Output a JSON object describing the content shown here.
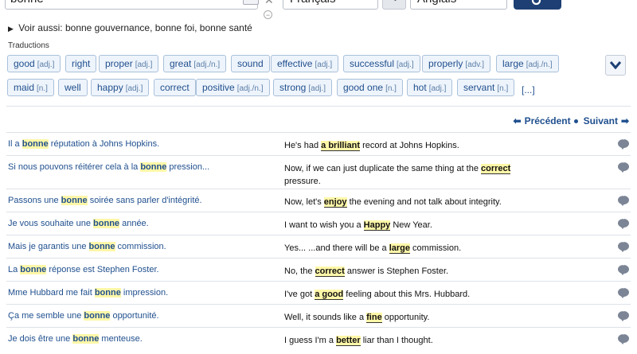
{
  "search": {
    "value": "bonne"
  },
  "lang": {
    "from": "Français",
    "to": "Anglais"
  },
  "see_also": {
    "label": "Voir aussi:",
    "items": [
      "bonne gouvernance",
      "bonne foi",
      "bonne santé"
    ],
    "sep": ", "
  },
  "translations_label": "Traductions",
  "chips": [
    {
      "word": "good",
      "pos": "[adj.]"
    },
    {
      "word": "right",
      "pos": ""
    },
    {
      "word": "proper",
      "pos": "[adj.]"
    },
    {
      "word": "great",
      "pos": "[adj./n.]"
    },
    {
      "word": "sound",
      "pos": ""
    },
    {
      "word": "effective",
      "pos": "[adj.]"
    },
    {
      "word": "successful",
      "pos": "[adj.]"
    },
    {
      "word": "properly",
      "pos": "[adv.]"
    },
    {
      "word": "large",
      "pos": "[adj./n.]"
    },
    {
      "word": "maid",
      "pos": "[n.]"
    },
    {
      "word": "well",
      "pos": ""
    },
    {
      "word": "happy",
      "pos": "[adj.]"
    },
    {
      "word": "correct",
      "pos": ""
    },
    {
      "word": "positive",
      "pos": "[adj./n.]"
    },
    {
      "word": "strong",
      "pos": "[adj.]"
    },
    {
      "word": "good one",
      "pos": "[n.]"
    },
    {
      "word": "hot",
      "pos": "[adj.]"
    },
    {
      "word": "servant",
      "pos": "[n.]"
    }
  ],
  "more_label": "[...]",
  "pager": {
    "prev": "Précédent",
    "next": "Suivant"
  },
  "rows": [
    {
      "src": [
        "Il a ",
        "bonne",
        " réputation à Johns Hopkins."
      ],
      "tgt": [
        "He's had ",
        "a brilliant",
        " record at Johns Hopkins."
      ]
    },
    {
      "src": [
        "Si nous pouvons réitérer cela à la ",
        "bonne",
        " pression..."
      ],
      "tgt": [
        "Now, if we can just duplicate the same thing at the ",
        "correct",
        " pressure."
      ]
    },
    {
      "src": [
        "Passons une ",
        "bonne",
        " soirée sans parler d'intégrité."
      ],
      "tgt": [
        "Now, let's ",
        "enjoy",
        " the evening and not talk about integrity."
      ]
    },
    {
      "src": [
        "Je vous souhaite une ",
        "bonne",
        " année."
      ],
      "tgt": [
        "I want to wish you a ",
        "Happy",
        " New Year."
      ]
    },
    {
      "src": [
        "Mais je garantis une ",
        "bonne",
        " commission."
      ],
      "tgt": [
        "Yes... ...and there will be a ",
        "large",
        " commission."
      ]
    },
    {
      "src": [
        "La ",
        "bonne",
        " réponse est Stephen Foster."
      ],
      "tgt": [
        "No, the ",
        "correct",
        " answer is Stephen Foster."
      ]
    },
    {
      "src": [
        "Mme Hubbard me fait ",
        "bonne",
        " impression."
      ],
      "tgt": [
        "I've got ",
        "a good",
        " feeling about this Mrs. Hubbard."
      ]
    },
    {
      "src": [
        "Ça me semble une ",
        "bonne",
        " opportunité."
      ],
      "tgt": [
        "Well, it sounds like a ",
        "fine",
        " opportunity."
      ]
    },
    {
      "src": [
        "Je dois être une ",
        "bonne",
        " menteuse."
      ],
      "tgt": [
        "I guess I'm a ",
        "better",
        " liar than I thought."
      ]
    }
  ]
}
